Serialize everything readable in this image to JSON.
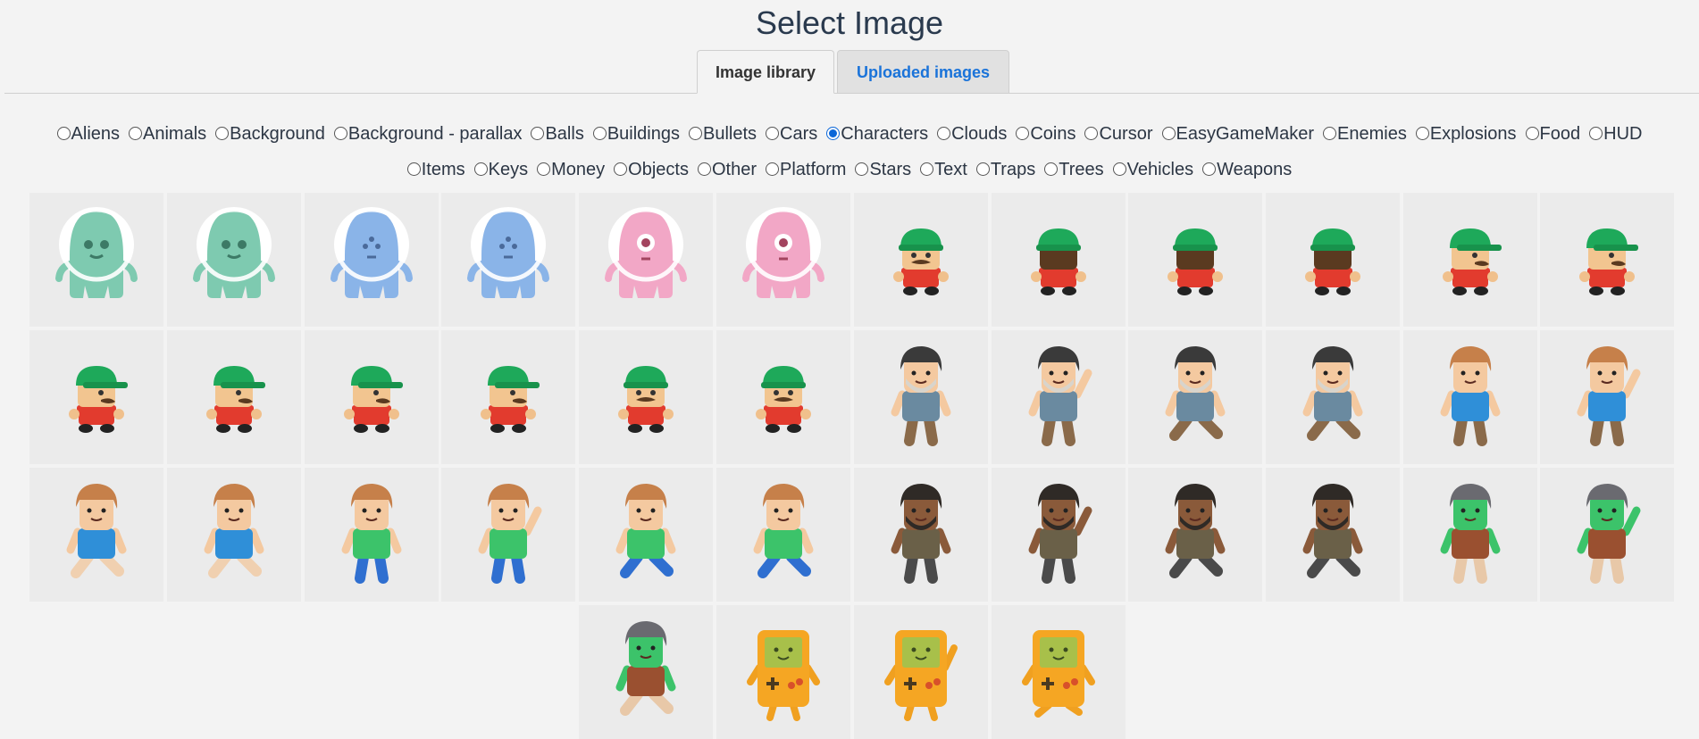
{
  "title": "Select Image",
  "tabs": [
    {
      "label": "Image library",
      "active": true
    },
    {
      "label": "Uploaded images",
      "active": false
    }
  ],
  "categories_row1": [
    "Aliens",
    "Animals",
    "Background",
    "Background - parallax",
    "Balls",
    "Buildings",
    "Bullets",
    "Cars",
    "Characters",
    "Clouds",
    "Coins",
    "Cursor",
    "EasyGameMaker",
    "Enemies",
    "Explosions",
    "Food",
    "HUD"
  ],
  "categories_row2": [
    "Items",
    "Keys",
    "Money",
    "Objects",
    "Other",
    "Platform",
    "Stars",
    "Text",
    "Traps",
    "Trees",
    "Vehicles",
    "Weapons"
  ],
  "selected_category": "Characters",
  "images": [
    {
      "kind": "alien",
      "color": "#7ecab0",
      "face": "two-eyes"
    },
    {
      "kind": "alien",
      "color": "#7ecab0",
      "face": "two-eyes"
    },
    {
      "kind": "alien",
      "color": "#8ab4e8",
      "face": "three-dots"
    },
    {
      "kind": "alien",
      "color": "#8ab4e8",
      "face": "three-dots"
    },
    {
      "kind": "alien",
      "color": "#f2a7c6",
      "face": "one-eye"
    },
    {
      "kind": "alien",
      "color": "#f2a7c6",
      "face": "one-eye"
    },
    {
      "kind": "plumber",
      "pose": "front"
    },
    {
      "kind": "plumber",
      "pose": "back"
    },
    {
      "kind": "plumber",
      "pose": "back"
    },
    {
      "kind": "plumber",
      "pose": "back"
    },
    {
      "kind": "plumber",
      "pose": "side"
    },
    {
      "kind": "plumber",
      "pose": "side"
    },
    {
      "kind": "plumber",
      "pose": "side"
    },
    {
      "kind": "plumber",
      "pose": "side"
    },
    {
      "kind": "plumber",
      "pose": "side"
    },
    {
      "kind": "plumber",
      "pose": "side"
    },
    {
      "kind": "plumber",
      "pose": "front"
    },
    {
      "kind": "plumber",
      "pose": "front"
    },
    {
      "kind": "person",
      "hair": "#3a3a3a",
      "shirt": "#6a8aa0",
      "skin": "#f4c9a0",
      "pants": "#8a6a4a",
      "beard": true,
      "pose": "stand"
    },
    {
      "kind": "person",
      "hair": "#3a3a3a",
      "shirt": "#6a8aa0",
      "skin": "#f4c9a0",
      "pants": "#8a6a4a",
      "beard": true,
      "pose": "wave"
    },
    {
      "kind": "person",
      "hair": "#3a3a3a",
      "shirt": "#6a8aa0",
      "skin": "#f4c9a0",
      "pants": "#8a6a4a",
      "beard": true,
      "pose": "walk"
    },
    {
      "kind": "person",
      "hair": "#3a3a3a",
      "shirt": "#6a8aa0",
      "skin": "#f4c9a0",
      "pants": "#8a6a4a",
      "beard": true,
      "pose": "walk"
    },
    {
      "kind": "person",
      "hair": "#c6804a",
      "shirt": "#2f8fd8",
      "skin": "#f4c9a0",
      "pants": "#8a6a4a",
      "beard": false,
      "pose": "stand"
    },
    {
      "kind": "person",
      "hair": "#c6804a",
      "shirt": "#2f8fd8",
      "skin": "#f4c9a0",
      "pants": "#8a6a4a",
      "beard": false,
      "pose": "wave"
    },
    {
      "kind": "person",
      "hair": "#c6804a",
      "shirt": "#2f8fd8",
      "skin": "#f4c9a0",
      "pants": "#f0d0b0",
      "beard": false,
      "pose": "walk"
    },
    {
      "kind": "person",
      "hair": "#c6804a",
      "shirt": "#2f8fd8",
      "skin": "#f4c9a0",
      "pants": "#f0d0b0",
      "beard": false,
      "pose": "walk"
    },
    {
      "kind": "person",
      "hair": "#c6804a",
      "shirt": "#3cc36a",
      "skin": "#f4c9a0",
      "pants": "#2f6fd0",
      "beard": false,
      "pose": "stand"
    },
    {
      "kind": "person",
      "hair": "#c6804a",
      "shirt": "#3cc36a",
      "skin": "#f4c9a0",
      "pants": "#2f6fd0",
      "beard": false,
      "pose": "wave"
    },
    {
      "kind": "person",
      "hair": "#c6804a",
      "shirt": "#3cc36a",
      "skin": "#f4c9a0",
      "pants": "#2f6fd0",
      "beard": false,
      "pose": "walk"
    },
    {
      "kind": "person",
      "hair": "#c6804a",
      "shirt": "#3cc36a",
      "skin": "#f4c9a0",
      "pants": "#2f6fd0",
      "beard": false,
      "pose": "walk"
    },
    {
      "kind": "person",
      "hair": "#2f2a26",
      "shirt": "#6a6048",
      "skin": "#8a5a3a",
      "pants": "#4a4a4a",
      "beard": true,
      "pose": "stand"
    },
    {
      "kind": "person",
      "hair": "#2f2a26",
      "shirt": "#6a6048",
      "skin": "#8a5a3a",
      "pants": "#4a4a4a",
      "beard": true,
      "pose": "wave"
    },
    {
      "kind": "person",
      "hair": "#2f2a26",
      "shirt": "#6a6048",
      "skin": "#8a5a3a",
      "pants": "#4a4a4a",
      "beard": true,
      "pose": "walk"
    },
    {
      "kind": "person",
      "hair": "#2f2a26",
      "shirt": "#6a6048",
      "skin": "#8a5a3a",
      "pants": "#4a4a4a",
      "beard": true,
      "pose": "walk"
    },
    {
      "kind": "person",
      "hair": "#6a6a70",
      "shirt": "#9a5030",
      "skin": "#3cc36a",
      "pants": "#e8c8a8",
      "beard": false,
      "pose": "stand"
    },
    {
      "kind": "person",
      "hair": "#6a6a70",
      "shirt": "#9a5030",
      "skin": "#3cc36a",
      "pants": "#e8c8a8",
      "beard": false,
      "pose": "wave"
    },
    {
      "kind": "person",
      "hair": "#6a6a70",
      "shirt": "#9a5030",
      "skin": "#3cc36a",
      "pants": "#e8c8a8",
      "beard": false,
      "pose": "walk"
    },
    {
      "kind": "gameboy",
      "pose": "stand"
    },
    {
      "kind": "gameboy",
      "pose": "wave"
    },
    {
      "kind": "gameboy",
      "pose": "walk"
    }
  ]
}
